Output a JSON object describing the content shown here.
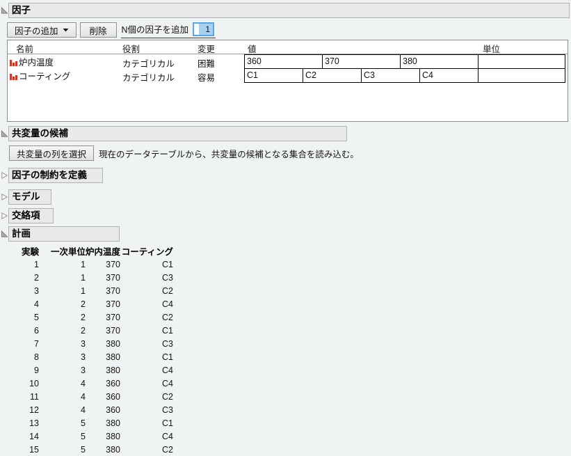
{
  "colors": {
    "background": "#f0f3f3",
    "header_bar": "#e9e9e9",
    "input_focus_border": "#58a6e8",
    "selection_highlight": "#a8d0f0",
    "nominal_icon_red": "#c63a2b",
    "cell_border": "#000000"
  },
  "icons": {
    "disclosure_open": "triangle-lower-left-filled",
    "disclosure_closed": "triangle-right-outline",
    "nominal_variable": "red-bar-chart",
    "dropdown_caret": "black-down-triangle"
  },
  "factors_section": {
    "title": "因子",
    "toolbar": {
      "add_factor_label": "因子の追加",
      "delete_label": "削除",
      "n_factors_label": "N個の因子を追加",
      "n_factors_value": "1"
    },
    "table": {
      "headers": [
        "名前",
        "役割",
        "変更",
        "値",
        "単位"
      ],
      "rows": [
        {
          "name": "炉内温度",
          "role": "カテゴリカル",
          "change": "困難",
          "values": [
            "360",
            "370",
            "380"
          ],
          "unit": ""
        },
        {
          "name": "コーティング",
          "role": "カテゴリカル",
          "change": "容易",
          "values": [
            "C1",
            "C2",
            "C3",
            "C4"
          ],
          "unit": ""
        }
      ]
    }
  },
  "covariates_section": {
    "title": "共変量の候補",
    "button_label": "共変量の列を選択",
    "description": "現在のデータテーブルから、共変量の候補となる集合を読み込む。"
  },
  "collapsed_sections": [
    {
      "title": "因子の制約を定義"
    },
    {
      "title": "モデル"
    },
    {
      "title": "交絡項"
    }
  ],
  "design_section": {
    "title": "計画",
    "table": {
      "headers": [
        "実験",
        "一次単位",
        "炉内温度",
        "コーティング"
      ],
      "rows": [
        [
          "1",
          "1",
          "370",
          "C1"
        ],
        [
          "2",
          "1",
          "370",
          "C3"
        ],
        [
          "3",
          "1",
          "370",
          "C2"
        ],
        [
          "4",
          "2",
          "370",
          "C4"
        ],
        [
          "5",
          "2",
          "370",
          "C2"
        ],
        [
          "6",
          "2",
          "370",
          "C1"
        ],
        [
          "7",
          "3",
          "380",
          "C3"
        ],
        [
          "8",
          "3",
          "380",
          "C1"
        ],
        [
          "9",
          "3",
          "380",
          "C4"
        ],
        [
          "10",
          "4",
          "360",
          "C4"
        ],
        [
          "11",
          "4",
          "360",
          "C2"
        ],
        [
          "12",
          "4",
          "360",
          "C3"
        ],
        [
          "13",
          "5",
          "380",
          "C1"
        ],
        [
          "14",
          "5",
          "380",
          "C4"
        ],
        [
          "15",
          "5",
          "380",
          "C2"
        ]
      ]
    }
  }
}
